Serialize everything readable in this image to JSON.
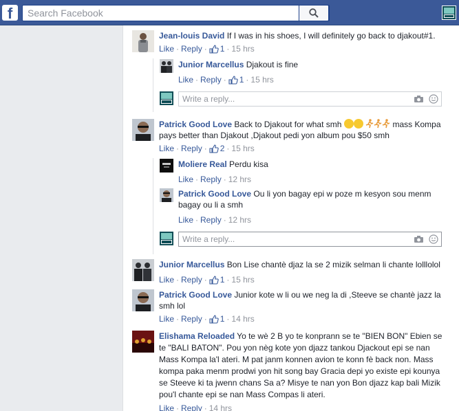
{
  "topbar": {
    "logo": "f",
    "search_placeholder": "Search Facebook"
  },
  "colors": {
    "brand": "#3b5998",
    "link": "#365899",
    "meta": "#90949c"
  },
  "comments": [
    {
      "author": "Jean-louis David",
      "text": "If I was in his shoes, I will definitely go back to djakout#1.",
      "like": "Like",
      "reply": "Reply",
      "likes": "1",
      "time": "15 hrs"
    },
    {
      "author": "Junior Marcellus",
      "text": "Djakout is fine",
      "like": "Like",
      "reply": "Reply",
      "likes": "1",
      "time": "15 hrs"
    },
    {
      "author": "Patrick Good Love",
      "text_a": "Back to Djakout for what smh",
      "text_b": "mass",
      "text_c": "Kompa pays better than Djakout ,Djakout pedi yon album pou $50 smh",
      "like": "Like",
      "reply": "Reply",
      "likes": "2",
      "time": "15 hrs"
    },
    {
      "author": "Moliere Real",
      "text": "Perdu kisa",
      "like": "Like",
      "reply": "Reply",
      "time": "12 hrs"
    },
    {
      "author": "Patrick Good Love",
      "text": "Ou li yon bagay epi w poze m kesyon sou menm bagay ou li a smh",
      "like": "Like",
      "reply": "Reply",
      "time": "12 hrs"
    },
    {
      "author": "Junior Marcellus",
      "text": "Bon Lise chantè djaz la se 2 mizik selman li chante lolllolol",
      "like": "Like",
      "reply": "Reply",
      "likes": "1",
      "time": "15 hrs"
    },
    {
      "author": "Patrick Good Love",
      "text": "Junior kote w li ou we neg la di ,Steeve se chantè jazz la smh lol",
      "like": "Like",
      "reply": "Reply",
      "likes": "1",
      "time": "14 hrs"
    },
    {
      "author": "Elishama Reloaded",
      "text": "Yo te wè 2 B yo te konprann se te \"BIEN BON\" Ebien se te \"BALI BATON\". Pou yon nèg kote yon djazz tankou Djackout epi se nan Mass Kompa la'l ateri. M pat janm konnen avion te konn fè back non. Mass kompa paka menm prodwi yon hit song bay Gracia depi yo existe epi kounya se Steeve ki ta jwenn chans Sa a? Misye te nan yon Bon djazz kap bali Mizik pou'l chante epi se nan Mass Compas li ateri.",
      "like": "Like",
      "reply": "Reply",
      "time": "14 hrs"
    }
  ],
  "reply_box": {
    "placeholder": "Write a reply..."
  },
  "icons": {
    "search": "search-icon",
    "camera": "camera-icon",
    "emoji": "emoji-icon",
    "thumb": "thumbs-up-icon"
  }
}
